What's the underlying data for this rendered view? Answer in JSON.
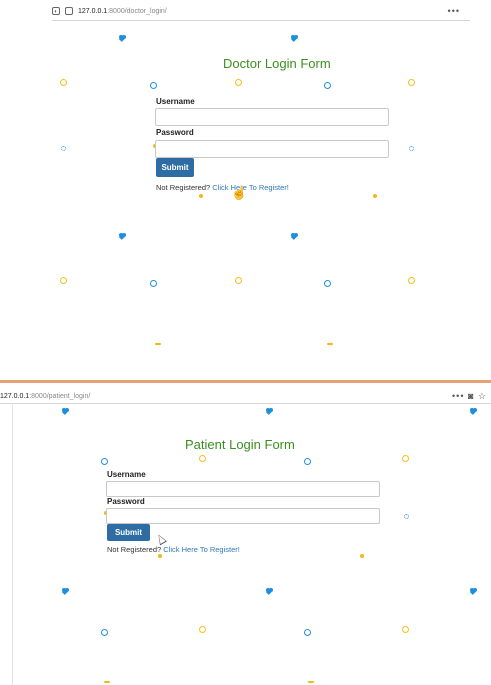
{
  "doctor": {
    "url_host": "127.0.0.1",
    "url_path": ":8000/doctor_login/",
    "menu": "•••",
    "title": "Doctor Login Form",
    "username_label": "Username",
    "password_label": "Password",
    "submit_label": "Submit",
    "register_prefix": "Not Registered?",
    "register_link": "Click Here To Register!"
  },
  "patient": {
    "url_host": "127.0.0.1",
    "url_path": ":8000/patient_login/",
    "menu": "•••",
    "title": "Patient Login Form",
    "username_label": "Username",
    "password_label": "Password",
    "submit_label": "Submit",
    "register_prefix": "Not Registered?",
    "register_link": "Click Here To Register!"
  },
  "colors": {
    "title": "#3a8f1f",
    "button": "#2e6da4",
    "link": "#2f79b8",
    "accent_blue": "#1e8fde",
    "accent_yellow": "#f2b81a",
    "divider": "#e8a07a"
  }
}
